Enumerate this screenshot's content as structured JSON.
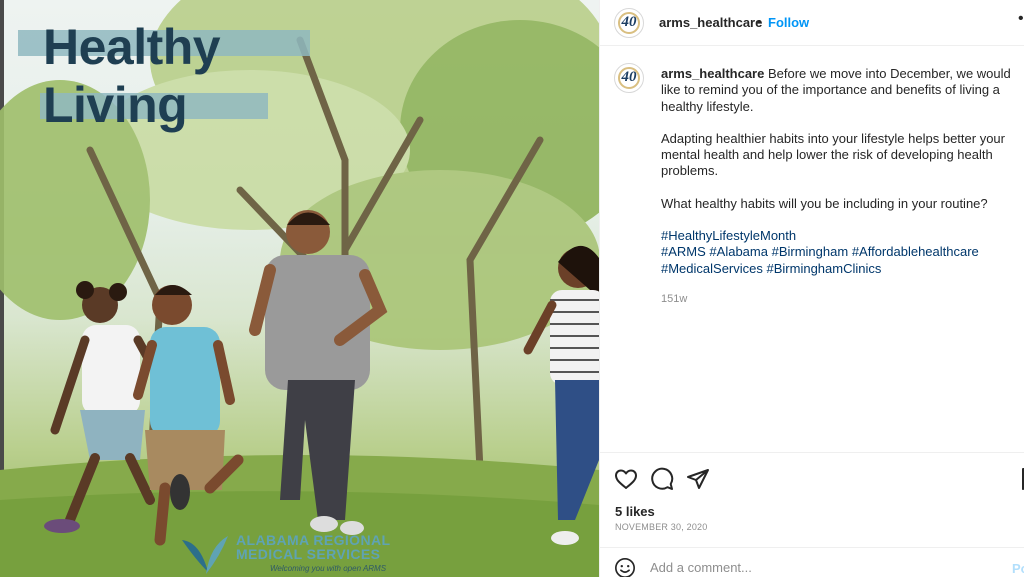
{
  "post_image": {
    "title_line1": "Healthy",
    "title_line2": "Living",
    "logo": {
      "line1": "ALABAMA REGIONAL",
      "line2": "MEDICAL SERVICES",
      "tagline": "Welcoming you with open ARMS"
    }
  },
  "header": {
    "avatar_text": "40",
    "username": "arms_healthcare",
    "separator": "•",
    "follow_label": "Follow",
    "more_icon": "more-options-icon"
  },
  "caption": {
    "avatar_text": "40",
    "username": "arms_healthcare",
    "para1": "Before we move into December, we would like to remind you of the importance and benefits of living a healthy lifestyle.",
    "para2": "Adapting healthier habits into your lifestyle helps better your mental health and help lower the risk of developing health problems.",
    "para3": "What healthy habits will you be including in your routine?",
    "hashtags": [
      "#HealthyLifestyleMonth",
      "#ARMS",
      "#Alabama",
      "#Birmingham",
      "#Affordablehealthcare",
      "#MedicalServices",
      "#BirminghamClinics"
    ],
    "age": "151w"
  },
  "actions": {
    "like_icon": "heart-icon",
    "comment_icon": "comment-icon",
    "share_icon": "share-icon",
    "save_icon": "bookmark-icon"
  },
  "stats": {
    "likes": "5 likes",
    "date": "NOVEMBER 30, 2020"
  },
  "comment_box": {
    "emoji_icon": "emoji-icon",
    "placeholder": "Add a comment...",
    "post_label": "Post"
  },
  "colors": {
    "accent": "#0095f6",
    "title_text": "#1f3f52",
    "title_bar": "#8fb8bf",
    "hashtag": "#00376b"
  }
}
